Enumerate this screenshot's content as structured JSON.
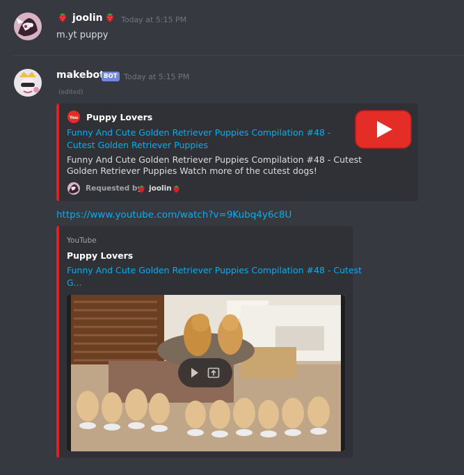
{
  "messages": {
    "first": {
      "username": "joolin",
      "timestamp": "Today at 5:15 PM",
      "text": "m.yt puppy"
    },
    "second": {
      "username": "makebot",
      "bot_tag": "BOT",
      "timestamp": "Today at 5:15 PM",
      "edited": "(edited)",
      "embed": {
        "author": "Puppy Lovers",
        "title_line1": "Funny And Cute Golden Retriever Puppies Compilation #48 -",
        "title_line2": "Cutest Golden Retriever Puppies",
        "desc_line1": "Funny And Cute Golden Retriever Puppies Compilation #48 - Cutest",
        "desc_line2": "Golden Retriever Puppies Watch more of the cutest dogs!",
        "footer_prefix": "Requested by",
        "footer_user": "joolin"
      },
      "link": "https://www.youtube.com/watch?v=9Kubq4y6c8U",
      "youtube_embed": {
        "provider": "YouTube",
        "author": "Puppy Lovers",
        "title_line1": "Funny And Cute Golden Retriever Puppies Compilation #48 - Cutest",
        "title_line2": "G..."
      }
    }
  },
  "colors": {
    "background": "#36393f",
    "embed_bg": "#2f3136",
    "embed_accent": "#e02020",
    "link": "#00b0f4",
    "bot_tag": "#7289da",
    "youtube_red": "#e52d27"
  },
  "icons": [
    "strawberry-icon",
    "youtube-icon",
    "play-icon",
    "popout-icon"
  ]
}
